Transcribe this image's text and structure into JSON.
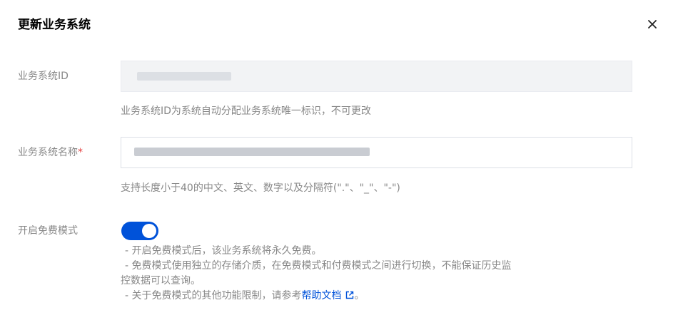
{
  "dialog": {
    "title": "更新业务系统",
    "close_icon": "close-icon"
  },
  "fields": {
    "system_id": {
      "label": "业务系统ID",
      "hint": "业务系统ID为系统自动分配业务系统唯一标识，不可更改"
    },
    "system_name": {
      "label": "业务系统名称",
      "required_mark": "*",
      "hint": "支持长度小于40的中文、英文、数字以及分隔符(\".\"、\"_\"、\"-\")"
    },
    "free_mode": {
      "label": "开启免费模式",
      "enabled": true,
      "desc_1": "- 开启免费模式后，该业务系统将永久免费。",
      "desc_2a": "- 免费模式使用独立的存储介质，在免费模式和付费模式之间进行切换，不能保证历史监",
      "desc_2b": "控数据可以查询。",
      "desc_3_prefix": "- 关于免费模式的其他功能限制，请参考",
      "desc_3_link": "帮助文档",
      "desc_3_suffix": "。"
    }
  },
  "colors": {
    "accent": "#0052d9",
    "label": "#888888",
    "required": "#e54545"
  }
}
